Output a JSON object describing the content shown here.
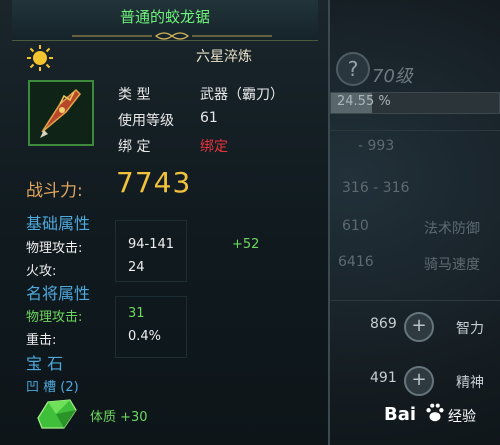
{
  "background": {
    "help_symbol": "?",
    "level_text": "70级",
    "exp_percent_text": "24.55 %",
    "exp_fraction": 0.2455,
    "stats": [
      {
        "text": "- 993"
      },
      {
        "text": "316 - 316"
      },
      {
        "text": "610"
      },
      {
        "text": "6416"
      },
      {
        "text": "869"
      },
      {
        "text": "491"
      }
    ],
    "side_labels": [
      "法术防御",
      "骑马速度",
      "智力",
      "精神"
    ],
    "plus_symbol": "+"
  },
  "tooltip": {
    "title": "普通的蛟龙锯",
    "quality": "六星淬炼",
    "info": [
      {
        "label": "类    型",
        "value": "武器（霸刀）"
      },
      {
        "label": "使用等级",
        "value": "61"
      },
      {
        "label": "绑    定",
        "value": "绑定"
      }
    ],
    "power_label": "战斗力:",
    "power_value": "7743",
    "base_section": "基础属性",
    "base_attrs": [
      {
        "label": "物理攻击:",
        "value": "94-141",
        "bonus": "+52"
      },
      {
        "label": "火攻:",
        "value": "24"
      }
    ],
    "general_section": "名将属性",
    "general_attrs": [
      {
        "label": "物理攻击:",
        "value": "31"
      },
      {
        "label": "重击:",
        "value": "0.4%"
      }
    ],
    "gem_section": "宝 石",
    "grooves": "凹 槽 (2)",
    "gem_bonus": "体质 +30"
  },
  "watermark": {
    "brand": "Bai",
    "sub": "经验"
  },
  "colors": {
    "title_green": "#6ef07a",
    "power_gold": "#f1c23c",
    "section_blue": "#4ea9dd",
    "bound_red": "#e8333a"
  }
}
